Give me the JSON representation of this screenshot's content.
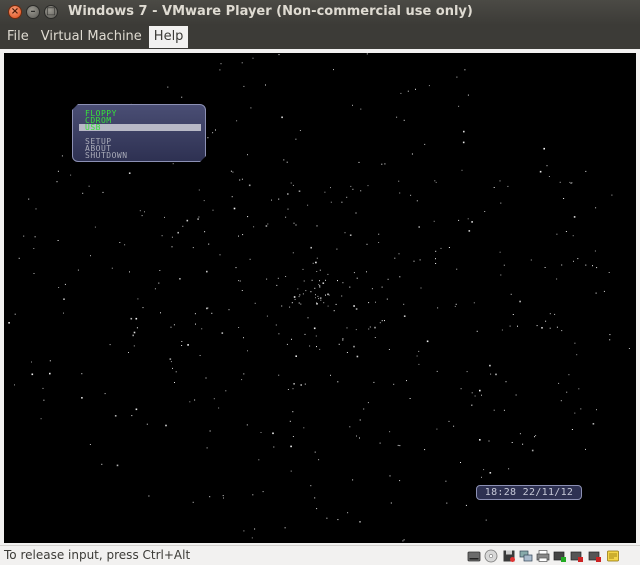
{
  "window": {
    "title": "Windows 7 - VMware Player (Non-commercial use only)",
    "controls": {
      "close": "×",
      "minimize": "–",
      "maximize": "□"
    }
  },
  "menubar": {
    "items": [
      {
        "label": "File",
        "active": false
      },
      {
        "label": "Virtual Machine",
        "active": false
      },
      {
        "label": "Help",
        "active": true
      }
    ]
  },
  "boot_menu": {
    "items": [
      {
        "label": "FLOPPY",
        "color": "green",
        "selected": false
      },
      {
        "label": "CDROM",
        "color": "green",
        "selected": false
      },
      {
        "label": "USB",
        "color": "green",
        "selected": true
      },
      {
        "label": "SETUP",
        "color": "grey",
        "selected": false
      },
      {
        "label": "ABOUT",
        "color": "grey",
        "selected": false
      },
      {
        "label": "SHUTDOWN",
        "color": "grey",
        "selected": false
      }
    ]
  },
  "clock": {
    "text": "18:28 22/11/12"
  },
  "statusbar": {
    "text": "To release input, press Ctrl+Alt",
    "device_icons": [
      "hard-disk-icon",
      "cd-drive-icon",
      "floppy-icon",
      "network-icon",
      "printer-icon",
      "usb-device-icon",
      "sound-card-icon",
      "message-icon"
    ]
  },
  "colors": {
    "accent_green": "#36e33a",
    "menu_bg": "#3c3b37",
    "boot_menu_bg": "#2e3152"
  }
}
